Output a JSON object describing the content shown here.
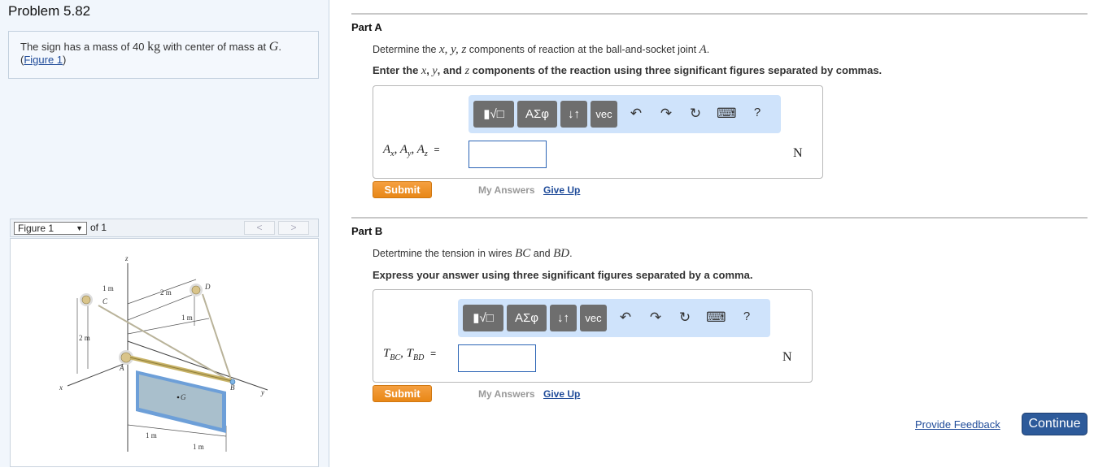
{
  "problem": {
    "title": "Problem 5.82",
    "statement_pre": "The sign has a mass of 40 ",
    "statement_unit": "kg",
    "statement_mid": " with center of mass at ",
    "statement_var": "G",
    "statement_post": ".",
    "figure_link": "Figure 1"
  },
  "figure_nav": {
    "selected": "Figure 1",
    "of_label": "of 1",
    "prev_icon": "<",
    "next_icon": ">"
  },
  "figure": {
    "labels": {
      "z": "z",
      "x": "x",
      "y": "y",
      "A": "A",
      "B": "B",
      "C": "C",
      "D": "D",
      "G": "G",
      "dim_1m_top": "1 m",
      "dim_2m_top": "2 m",
      "dim_1m_side": "1 m",
      "dim_2m_left": "2 m",
      "dim_1m_bottom_left": "1 m",
      "dim_1m_bottom_right": "1 m"
    }
  },
  "toolbar": {
    "templates_label": "▮√□",
    "greek_label": "ΑΣφ",
    "arrows_label": "↓↑",
    "vec_label": "vec",
    "undo_icon": "↶",
    "redo_icon": "↷",
    "reset_icon": "↻",
    "keyboard_icon": "⌨",
    "help_label": "?"
  },
  "partA": {
    "heading": "Part A",
    "question_pre": "Determine the ",
    "q_vars": "x, y, z",
    "question_mid": " components of reaction at the ball-and-socket joint ",
    "q_point": "A",
    "question_post": ".",
    "instruction_pre": "Enter the ",
    "i_x": "x",
    "i_sep1": ", ",
    "i_y": "y",
    "i_sep2": ", and ",
    "i_z": "z",
    "instruction_post": " components of the reaction using three significant figures separated by commas.",
    "answer_label": {
      "A1": "A",
      "s1": "x",
      "A2": "A",
      "s2": "y",
      "A3": "A",
      "s3": "z",
      "eq": "="
    },
    "answer_value": "",
    "unit": "N",
    "submit_label": "Submit",
    "my_answers_label": "My Answers",
    "give_up_label": "Give Up"
  },
  "partB": {
    "heading": "Part B",
    "question_pre": "Detertmine the tension in wires ",
    "q_w1": "BC",
    "question_mid": " and ",
    "q_w2": "BD",
    "question_post": ".",
    "instruction": "Express your answer using three significant figures separated by a comma.",
    "answer_label": {
      "T1": "T",
      "s1": "BC",
      "T2": "T",
      "s2": "BD",
      "eq": "="
    },
    "answer_value": "",
    "unit": "N",
    "submit_label": "Submit",
    "my_answers_label": "My Answers",
    "give_up_label": "Give Up"
  },
  "footer": {
    "feedback_label": "Provide Feedback",
    "continue_label": "Continue"
  }
}
